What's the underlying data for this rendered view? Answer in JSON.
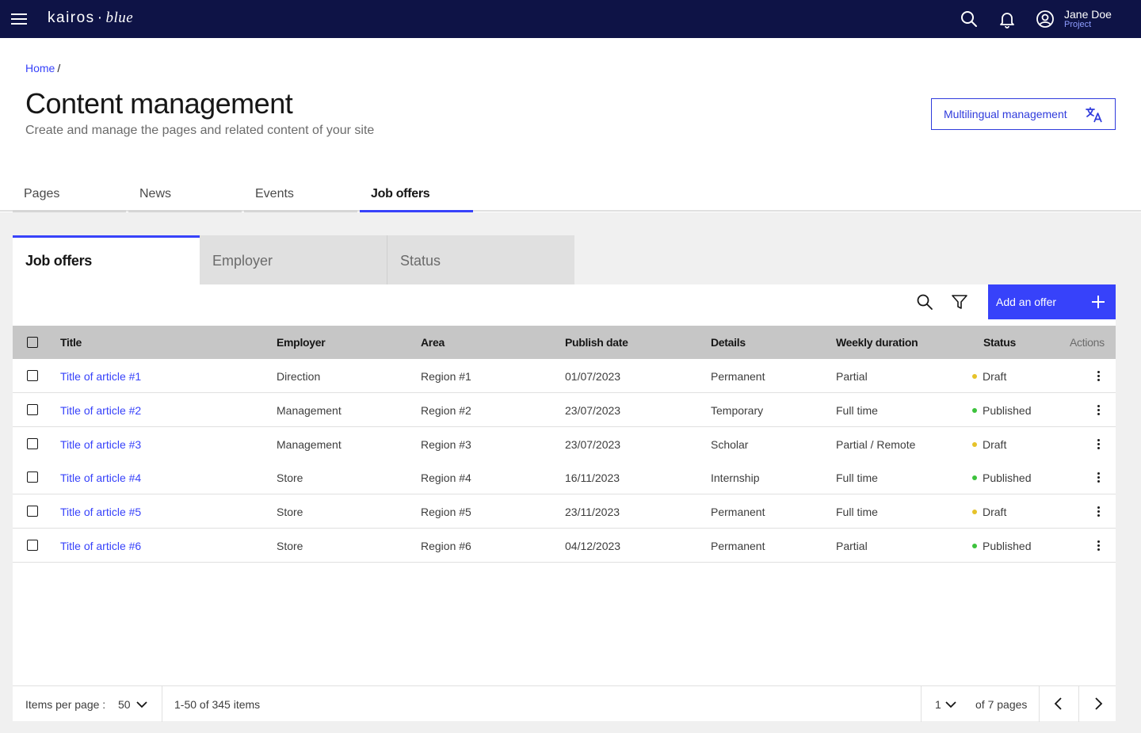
{
  "topbar": {
    "logo_brand": "kairos",
    "logo_dot": "·",
    "logo_sub": "blue",
    "user_name": "Jane Doe",
    "user_role": "Project",
    "icons": [
      "hamburger-menu-icon",
      "search-icon",
      "bell-icon",
      "user-circle-icon"
    ]
  },
  "breadcrumb": {
    "home": "Home",
    "separator": "/"
  },
  "header": {
    "title": "Content management",
    "subtitle": "Create and manage the pages and related content of your site",
    "multilingual_label": "Multilingual management"
  },
  "main_tabs": [
    {
      "label": "Pages",
      "active": false
    },
    {
      "label": "News",
      "active": false
    },
    {
      "label": "Events",
      "active": false
    },
    {
      "label": "Job offers",
      "active": true
    }
  ],
  "sub_tabs": [
    {
      "label": "Job offers",
      "active": true
    },
    {
      "label": "Employer",
      "active": false
    },
    {
      "label": "Status",
      "active": false
    }
  ],
  "toolbar": {
    "add_label": "Add an offer"
  },
  "table": {
    "columns": {
      "title": "Title",
      "employer": "Employer",
      "area": "Area",
      "publish_date": "Publish date",
      "details": "Details",
      "weekly_duration": "Weekly duration",
      "status": "Status",
      "actions": "Actions"
    },
    "rows": [
      {
        "title": "Title of article #1",
        "employer": "Direction",
        "area": "Region #1",
        "publish_date": "01/07/2023",
        "details": "Permanent",
        "weekly_duration": "Partial",
        "status": "Draft"
      },
      {
        "title": "Title of article #2",
        "employer": "Management",
        "area": "Region #2",
        "publish_date": "23/07/2023",
        "details": "Temporary",
        "weekly_duration": "Full time",
        "status": "Published"
      },
      {
        "title": "Title of article #3",
        "employer": "Management",
        "area": "Region #3",
        "publish_date": "23/07/2023",
        "details": "Scholar",
        "weekly_duration": "Partial / Remote",
        "status": "Draft"
      },
      {
        "title": "Title of article #4",
        "employer": "Store",
        "area": "Region #4",
        "publish_date": "16/11/2023",
        "details": "Internship",
        "weekly_duration": "Full time",
        "status": "Published"
      },
      {
        "title": "Title of article #5",
        "employer": "Store",
        "area": "Region #5",
        "publish_date": "23/11/2023",
        "details": "Permanent",
        "weekly_duration": "Full time",
        "status": "Draft"
      },
      {
        "title": "Title of article #6",
        "employer": "Store",
        "area": "Region #6",
        "publish_date": "04/12/2023",
        "details": "Permanent",
        "weekly_duration": "Partial",
        "status": "Published"
      }
    ]
  },
  "status_colors": {
    "Draft": "#e6c229",
    "Published": "#3cc23c"
  },
  "pagination": {
    "items_per_page_label": "Items per page :",
    "items_per_page_value": "50",
    "range_label": "1-50 of 345 items",
    "current_page": "1",
    "pages_label": "of 7 pages"
  },
  "colors": {
    "topbar": "#0e1346",
    "accent": "#3742fa"
  }
}
